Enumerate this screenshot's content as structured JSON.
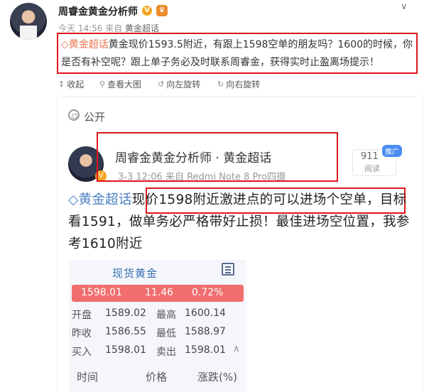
{
  "post": {
    "author": "周睿金黄金分析师",
    "verified_icon": "V",
    "member_icon": "♛",
    "meta_time": "今天 14:56 来自",
    "meta_source": "黄金超话",
    "topic": "黄金超话",
    "text": "黄金现价1593.5附近，有跟上1598空单的朋友吗？1600的时候，你是否有补空呢？跟上单子务必及时联系周睿金，获得实时止盈离场提示！"
  },
  "actions": [
    {
      "icon": "collapse-icon",
      "label": "收起"
    },
    {
      "icon": "zoom-icon",
      "label": "查看大图"
    },
    {
      "icon": "rotate-left-icon",
      "label": "向左旋转"
    },
    {
      "icon": "rotate-right-icon",
      "label": "向右旋转"
    }
  ],
  "screenshot": {
    "public_label": "公开",
    "author_line": "周睿金黄金分析师 · 黄金超话",
    "meta": "3-3 12:06  来自 Redmi Note 8 Pro四摄",
    "read_count": "911",
    "read_label": "阅读",
    "promo": "推广",
    "topic": "黄金超话",
    "text": "现价1598附近激进点的可以进场个空单，目标看1591，做单务必严格带好止损！最佳进场空位置，我参考1610附近",
    "quote": {
      "title": "现货黄金",
      "price": "1598.01",
      "change": "11.46",
      "change_pct": "0.72%",
      "rows": [
        {
          "l1": "开盘",
          "v1": "1589.02",
          "l2": "最高",
          "v2": "1600.14"
        },
        {
          "l1": "昨收",
          "v1": "1586.55",
          "l2": "最低",
          "v2": "1588.97"
        },
        {
          "l1": "买入",
          "v1": "1598.01",
          "l2": "卖出",
          "v2": "1598.01"
        }
      ],
      "columns": [
        "时间",
        "价格",
        "涨跌(%)"
      ]
    }
  },
  "colors": {
    "highlight_border": "#e0151b",
    "topic": "#eb7350",
    "price_bar": "#f06e6e"
  }
}
